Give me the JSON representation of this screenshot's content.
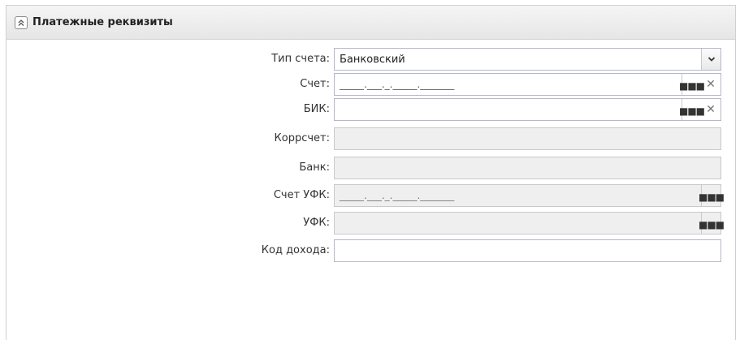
{
  "panel": {
    "title": "Платежные реквизиты"
  },
  "fields": {
    "account_type": {
      "label": "Тип счета:",
      "value": "Банковский"
    },
    "account": {
      "label": "Счет:",
      "mask": "_____.___._._____._______"
    },
    "bik": {
      "label": "БИК:",
      "value": ""
    },
    "corr_account": {
      "label": "Коррсчет:",
      "value": ""
    },
    "bank": {
      "label": "Банк:",
      "value": ""
    },
    "ufk_account": {
      "label": "Счет УФК:",
      "mask": "_____.___._._____._______"
    },
    "ufk": {
      "label": "УФК:",
      "value": ""
    },
    "income_code": {
      "label": "Код дохода:",
      "value": ""
    }
  },
  "icons": {
    "collapse": "double-chevron-up-icon",
    "dropdown": "chevron-down-icon",
    "lookup": "ellipsis-icon",
    "clear": "close-icon"
  }
}
